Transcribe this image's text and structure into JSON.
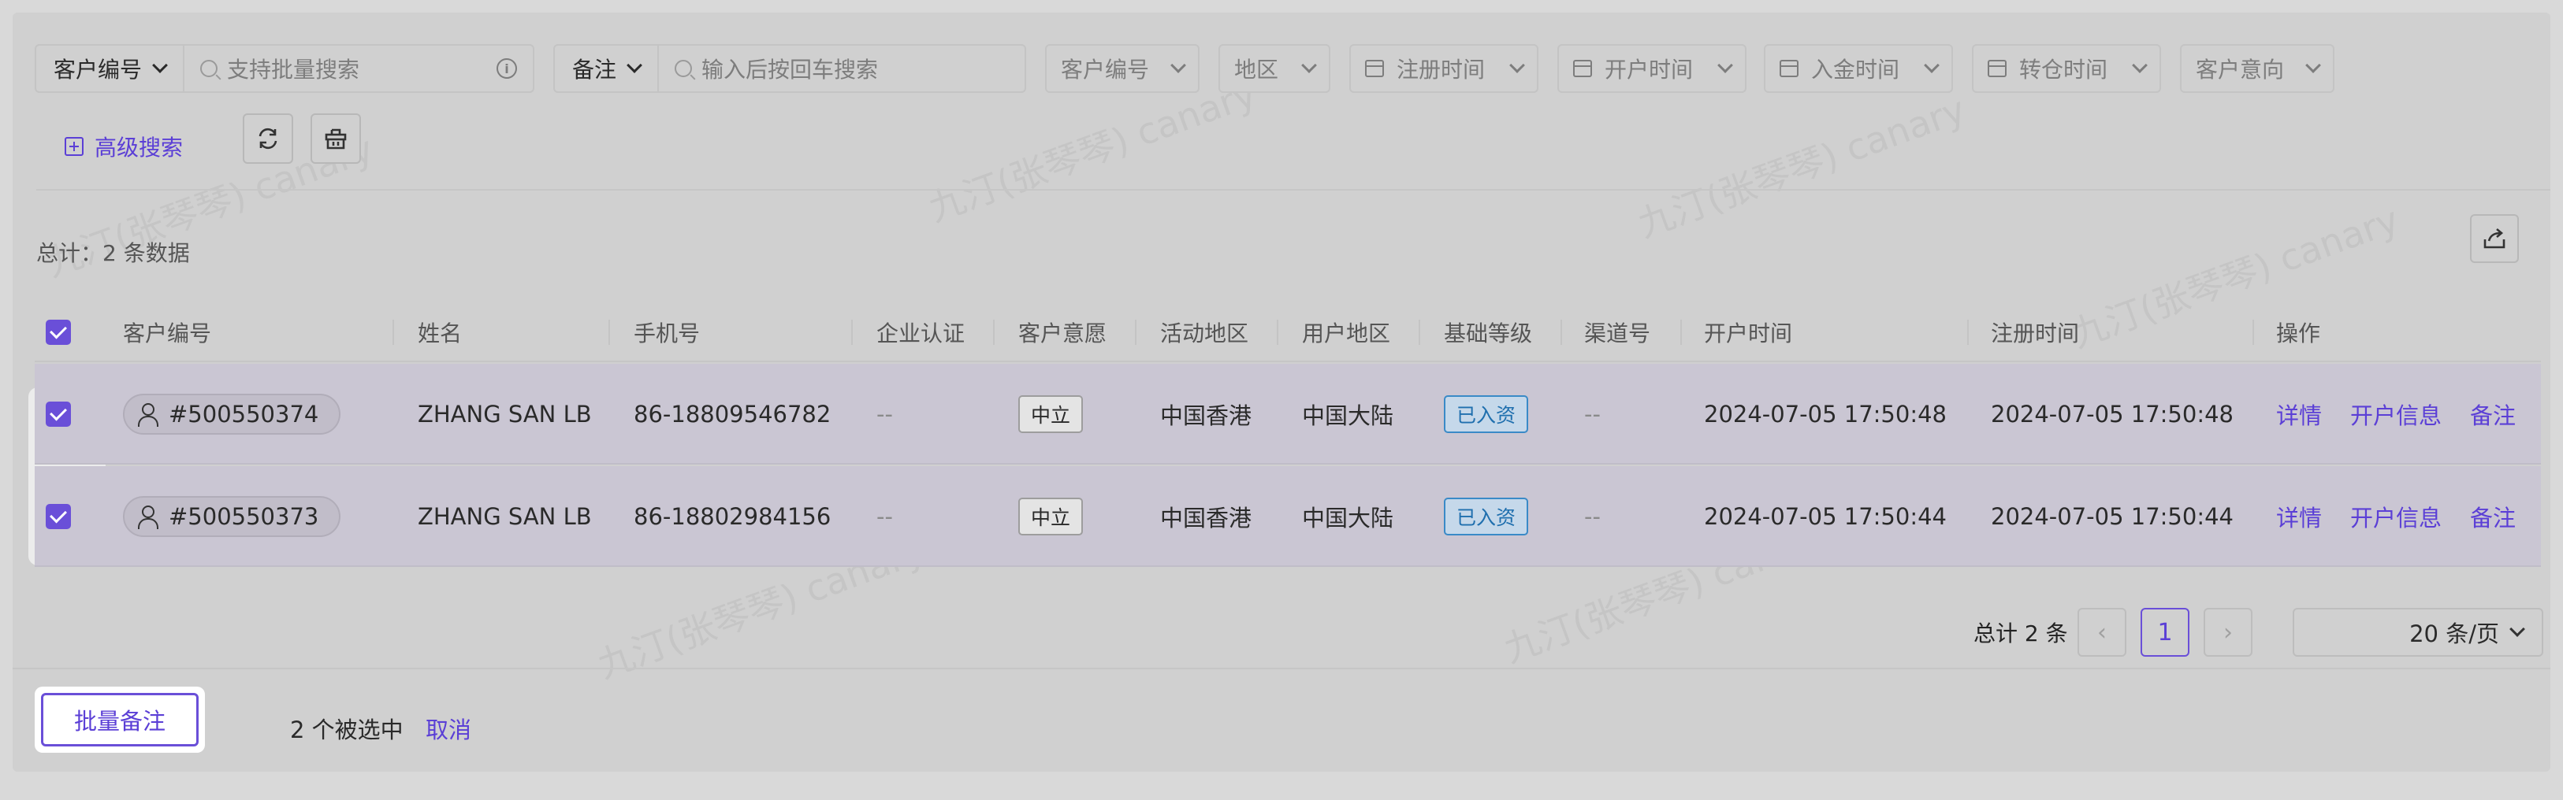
{
  "filters": {
    "customer_id_select": "客户编号",
    "batch_search_placeholder": "支持批量搜索",
    "remark_select": "备注",
    "remark_search_placeholder": "输入后按回车搜索",
    "dropdowns": [
      "客户编号",
      "地区"
    ],
    "date_filters": [
      "注册时间",
      "开户时间",
      "入金时间",
      "转仓时间"
    ],
    "intention": "客户意向",
    "advanced_search": "高级搜索"
  },
  "summary": {
    "total_text": "总计：2 条数据"
  },
  "watermark": "九汀(张琴琴) canary",
  "table": {
    "columns": [
      "客户编号",
      "姓名",
      "手机号",
      "企业认证",
      "客户意愿",
      "活动地区",
      "用户地区",
      "基础等级",
      "渠道号",
      "开户时间",
      "注册时间",
      "操作"
    ],
    "rows": [
      {
        "customer_id": "#500550374",
        "name": "ZHANG SAN LB",
        "phone": "86-18809546782",
        "enterprise": "--",
        "intention": "中立",
        "activity_region": "中国香港",
        "user_region": "中国大陆",
        "level": "已入资",
        "channel": "--",
        "open_time": "2024-07-05 17:50:48",
        "register_time": "2024-07-05 17:50:48",
        "selected": true
      },
      {
        "customer_id": "#500550373",
        "name": "ZHANG SAN LB",
        "phone": "86-18802984156",
        "enterprise": "--",
        "intention": "中立",
        "activity_region": "中国香港",
        "user_region": "中国大陆",
        "level": "已入资",
        "channel": "--",
        "open_time": "2024-07-05 17:50:44",
        "register_time": "2024-07-05 17:50:44",
        "selected": true
      }
    ],
    "actions": [
      "详情",
      "开户信息",
      "备注"
    ]
  },
  "pagination": {
    "total_text": "总计 2 条",
    "current_page": "1",
    "page_size": "20 条/页",
    "prev_icon": "‹",
    "next_icon": "›"
  },
  "footer": {
    "batch_remark": "批量备注",
    "selected_text": "2 个被选中",
    "cancel": "取消"
  },
  "colors": {
    "accent": "#5b3fd6",
    "funded_tag": "#1f6fae"
  }
}
